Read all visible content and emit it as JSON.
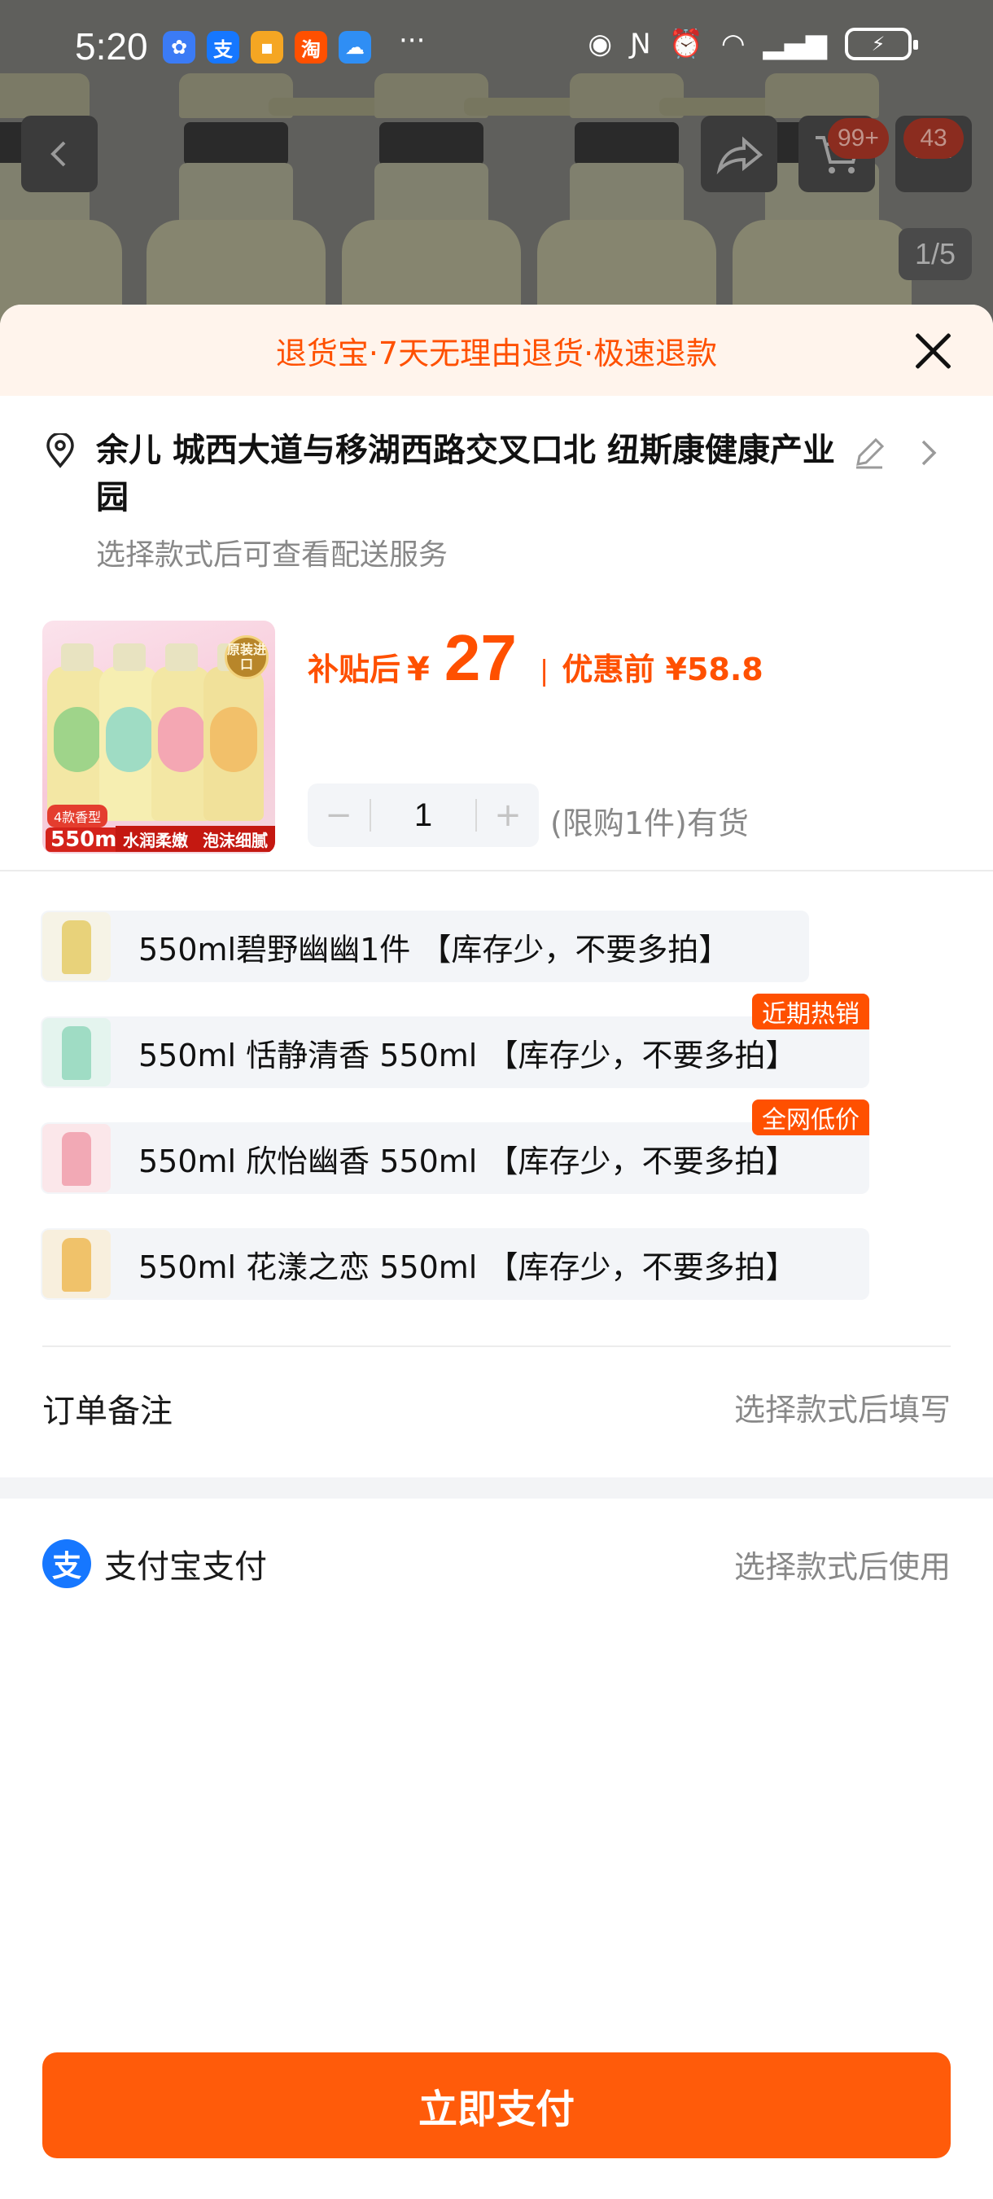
{
  "status_bar": {
    "time": "5:20",
    "battery_icon": "battery-charging-icon",
    "app_icons": [
      "baidu-icon",
      "alipay-icon",
      "note-icon",
      "taobao-icon",
      "weather-icon"
    ]
  },
  "top_controls": {
    "cart_badge": "99+",
    "more_badge": "43",
    "image_pager": "1/5"
  },
  "sheet": {
    "promo_banner": "退货宝·7天无理由退货·极速退款",
    "address": {
      "text": "余儿 城西大道与移湖西路交叉口北 纽斯康健康产业园",
      "subtext": "选择款式后可查看配送服务"
    },
    "product": {
      "thumb_seal": "原装进口",
      "thumb_tag": "4款香型",
      "thumb_size": "550ml",
      "thumb_slogan_1": "水润柔嫩",
      "thumb_slogan_2": "泡沫细腻",
      "price_label": "补贴后",
      "currency": "¥",
      "price": "27",
      "separator": "|",
      "original_label": "优惠前 ¥58.8",
      "quantity_minus": "−",
      "quantity": "1",
      "quantity_plus": "+",
      "stock_text": "(限购1件)有货"
    },
    "options": [
      {
        "label": "550ml碧野幽幽1件 【库存少，不要多拍】",
        "tag": "",
        "color": "#ecd98a"
      },
      {
        "label": "550ml 恬静清香 550ml 【库存少，不要多拍】",
        "tag": "近期热销",
        "color": "#8fd6b8"
      },
      {
        "label": "550ml 欣怡幽香 550ml 【库存少，不要多拍】",
        "tag": "全网低价",
        "color": "#f2a9b5"
      },
      {
        "label": "550ml 花漾之恋 550ml 【库存少，不要多拍】",
        "tag": "",
        "color": "#f0c26a"
      }
    ],
    "remark": {
      "label": "订单备注",
      "value": "选择款式后填写"
    },
    "payment": {
      "label": "支付宝支付",
      "value": "选择款式后使用",
      "icon_glyph": "支"
    },
    "pay_button": "立即支付"
  }
}
